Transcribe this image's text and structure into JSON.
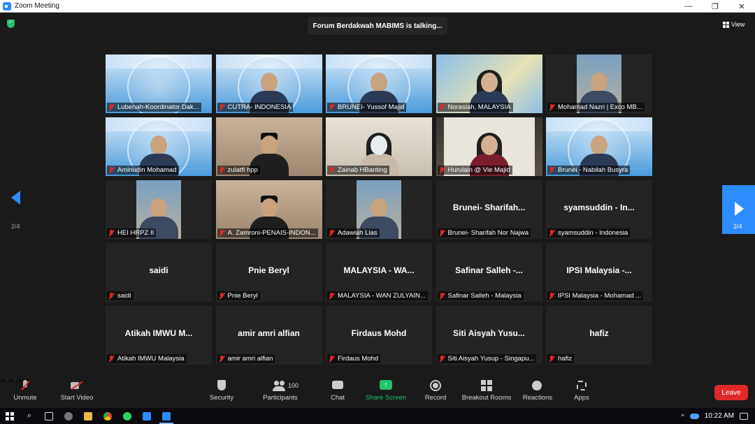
{
  "window": {
    "title": "Zoom Meeting",
    "controls": [
      "—",
      "❐",
      "✕"
    ]
  },
  "meeting": {
    "speaking_banner": "Forum Berdakwah MABIMS is talking...",
    "view_label": "View",
    "page_indicator_left": "2/4",
    "page_indicator_right": "2/4"
  },
  "participants": [
    {
      "label": "Lubenah-Koordinator Dak...",
      "video": "banner",
      "muted": true
    },
    {
      "label": "CUTRA- INDONESIA",
      "video": "banner-person",
      "muted": true
    },
    {
      "label": "BRUNEI- Yussof Majid",
      "video": "banner-person",
      "muted": true
    },
    {
      "label": "Norasiah, MALAYSIA",
      "video": "map-person",
      "muted": true
    },
    {
      "label": "Mohamad Nazri | Exco MB...",
      "video": "narrow",
      "muted": true
    },
    {
      "label": "Aminudin Mohamad",
      "video": "banner-person",
      "muted": true
    },
    {
      "label": "zulatfi hpp",
      "video": "office-person",
      "muted": true
    },
    {
      "label": "Zainab HBanting",
      "video": "light-person",
      "muted": true
    },
    {
      "label": "Hurulain @ Vie Majid",
      "video": "room-person",
      "muted": true
    },
    {
      "label": "Brunei - Nabilah Busyra",
      "video": "banner-person",
      "muted": true
    },
    {
      "label": "HEI HRPZ II",
      "video": "narrow",
      "muted": true
    },
    {
      "label": "A. Zamroni-PENAIS-INDON...",
      "video": "office-person",
      "muted": true
    },
    {
      "label": "Adawiah Lias",
      "video": "narrow",
      "muted": true
    },
    {
      "label": "Brunei- Sharifah Nor Najwa",
      "name": "Brunei- Sharifah...",
      "video": "none",
      "muted": true
    },
    {
      "label": "syamsuddin - Indonesia",
      "name": "syamsuddin - In...",
      "video": "none",
      "muted": true
    },
    {
      "label": "saidi",
      "name": "saidi",
      "video": "none",
      "muted": true
    },
    {
      "label": "Pnie Beryl",
      "name": "Pnie Beryl",
      "video": "none",
      "muted": true
    },
    {
      "label": "MALAYSIA - WAN ZULYAIN...",
      "name": "MALAYSIA - WA...",
      "video": "none",
      "muted": true
    },
    {
      "label": "Safinar Salleh - Malaysia",
      "name": "Safinar Salleh -...",
      "video": "none",
      "muted": true
    },
    {
      "label": "IPSI Malaysia - Mohamad ...",
      "name": "IPSI Malaysia -...",
      "video": "none",
      "muted": true
    },
    {
      "label": "Atikah IMWU Malaysia",
      "name": "Atikah IMWU M...",
      "video": "none",
      "muted": true
    },
    {
      "label": "amir amri alfian",
      "name": "amir amri alfian",
      "video": "none",
      "muted": true
    },
    {
      "label": "Firdaus Mohd",
      "name": "Firdaus Mohd",
      "video": "none",
      "muted": true
    },
    {
      "label": "Siti Aisyah Yusup - Singapu...",
      "name": "Siti Aisyah Yusu...",
      "video": "none",
      "muted": true
    },
    {
      "label": "hafiz",
      "name": "hafiz",
      "video": "none",
      "muted": true
    }
  ],
  "toolbar": {
    "unmute": "Unmute",
    "start_video": "Start Video",
    "security": "Security",
    "participants": "Participants",
    "participants_count": "100",
    "chat": "Chat",
    "share_screen": "Share Screen",
    "record": "Record",
    "breakout_rooms": "Breakout Rooms",
    "reactions": "Reactions",
    "apps": "Apps",
    "leave": "Leave"
  },
  "taskbar": {
    "time": "10:22 AM"
  },
  "colors": {
    "accent": "#2d8cff",
    "share_green": "#23c16b",
    "leave_red": "#e02828",
    "background": "#1a1a1a"
  }
}
